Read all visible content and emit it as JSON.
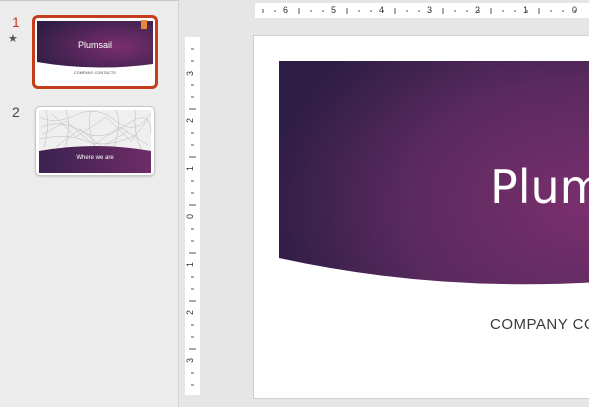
{
  "thumbnails": [
    {
      "number": "1",
      "title": "Plumsail",
      "subtitle": "COMPANY CONTACTS",
      "selected": true,
      "has_animation": true
    },
    {
      "number": "2",
      "title": "Where we are",
      "selected": false
    }
  ],
  "animation_marker": "★",
  "horizontal_ruler": {
    "labels": [
      "6",
      "5",
      "4",
      "3",
      "2",
      "1",
      "0"
    ]
  },
  "vertical_ruler": {
    "labels": [
      "3",
      "2",
      "1",
      "0",
      "1",
      "2",
      "3"
    ]
  },
  "slide": {
    "title": "Plumsail",
    "subtitle": "COMPANY CONTACTS"
  },
  "colors": {
    "selection_border": "#c43e1c",
    "banner_dark": "#2e1d45",
    "banner_light": "#7a2f6d",
    "comment_flag": "#e8893a"
  }
}
